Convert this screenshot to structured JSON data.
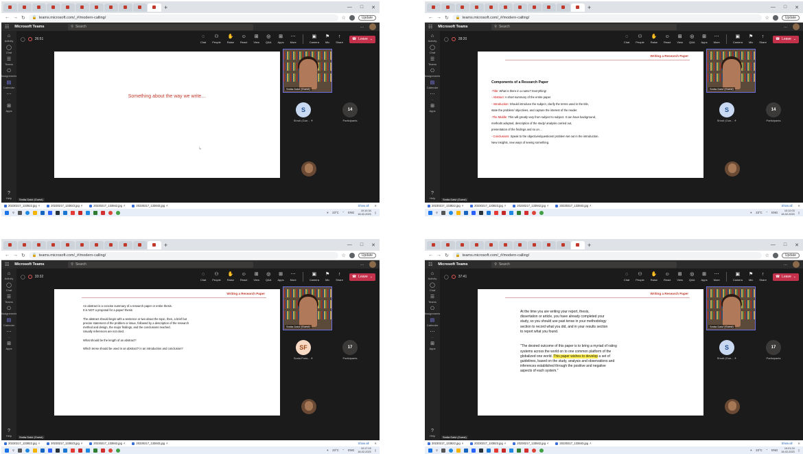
{
  "browser": {
    "url": "teams.microsoft.com/_#/modern-calling/",
    "update_label": "Update",
    "new_tab": "+"
  },
  "teams": {
    "app_name": "Microsoft Teams",
    "search_placeholder": "Search",
    "more": "...",
    "rail": [
      {
        "label": "Activity",
        "icon": "bell-icon"
      },
      {
        "label": "Chat",
        "icon": "chat-icon"
      },
      {
        "label": "Teams",
        "icon": "teams-icon"
      },
      {
        "label": "Assignments",
        "icon": "assignments-icon"
      },
      {
        "label": "Calendar",
        "icon": "calendar-icon"
      },
      {
        "label": "...",
        "icon": "more-icon"
      },
      {
        "label": "Apps",
        "icon": "apps-icon"
      },
      {
        "label": "Help",
        "icon": "help-icon"
      }
    ],
    "toolbar": [
      {
        "label": "Chat"
      },
      {
        "label": "People"
      },
      {
        "label": "Raise"
      },
      {
        "label": "React"
      },
      {
        "label": "View"
      },
      {
        "label": "Q&A"
      },
      {
        "label": "Apps"
      },
      {
        "label": "More"
      }
    ],
    "devices": [
      {
        "label": "Camera"
      },
      {
        "label": "Mic"
      },
      {
        "label": "Share"
      }
    ],
    "leave_label": "Leave"
  },
  "downloads": {
    "files": [
      "20230217_133822.jpg",
      "20230217_133823.jpg",
      "20230217_133842.jpg",
      "20230217_133843.jpg"
    ],
    "show_all": "Show all"
  },
  "taskbar": {
    "temp": "23°C",
    "lang": "ENG",
    "date": "18-02-2023"
  },
  "shots": [
    {
      "timer": "26:51",
      "clock": "10:10:34",
      "speaker_name": "Smita Dalvi (Guest)",
      "slide_title": "",
      "slide_center_text": "Something about the way we write…",
      "lines": [],
      "tile2": {
        "initials": "S",
        "name": "Shruti (Gue..."
      },
      "participant_count": "14",
      "participants_label": "Participants",
      "guest_label": "Smita Dalvi (Guest)"
    },
    {
      "timer": "28:20",
      "clock": "10:12:03",
      "speaker_name": "Smita Dalvi (Guest)",
      "slide_title": "Writing a Research Paper",
      "slide_center_text": "",
      "heading": "Components of a Research Paper",
      "lines": [
        {
          "label": "-Title:",
          "text": " What is there in a name? Everything!"
        },
        {
          "label": "- Abstract:",
          "text": " A short summary of the entire paper"
        },
        {
          "label": " - Introduction:",
          "text": " Should introduce the subject, clarify the terms used in the title,"
        },
        {
          "label": "",
          "text": "          state the problem/ objectives, and capture the interest of the reader."
        },
        {
          "label": "-The Middle:",
          "text": " This will greatly vary from subject to subject. It can have background,"
        },
        {
          "label": "",
          "text": "          methods adopted, description of the study/ analysis carried out,"
        },
        {
          "label": "",
          "text": "          presentation of the findings and so on…"
        },
        {
          "label": " - Conclusions:",
          "text": " Speak to the objectives/questions/ problem set out in the introduction."
        },
        {
          "label": "",
          "text": "          New insights, new ways of seeing something."
        }
      ],
      "tile2": {
        "initials": "S",
        "name": "Shruti (Gue..."
      },
      "participant_count": "14",
      "participants_label": "Participants",
      "guest_label": "Smita Dalvi (Guest)"
    },
    {
      "timer": "33:32",
      "clock": "10:17:15",
      "speaker_name": "Smita Dalvi (Guest)",
      "slide_title": "Writing a Research Paper",
      "slide_center_text": "",
      "heading": "",
      "lines": [
        {
          "label": "",
          "text": "An abstract is a concise summary of a research paper or entire thesis."
        },
        {
          "label": "",
          "text": "It is NOT a proposal for a paper/ thesis"
        },
        {
          "label": "",
          "text": ""
        },
        {
          "label": "",
          "text": "The abstract should begin with a sentence or two about the topic, then, a brief but"
        },
        {
          "label": "",
          "text": "precise statement of the problem or issue, followed by a description of the research"
        },
        {
          "label": "",
          "text": "method and design, the major findings, and the conclusions reached."
        },
        {
          "label": "",
          "text": "Usually references are not cited."
        },
        {
          "label": "",
          "text": ""
        },
        {
          "label": "",
          "text": "What should be the length of an abstract?"
        },
        {
          "label": "",
          "text": ""
        },
        {
          "label": "",
          "text": "Which tense should be used in an abstract? in an introduction and conclusion?"
        }
      ],
      "tile2": {
        "initials": "SF",
        "name": "Sonia Fons..."
      },
      "participant_count": "17",
      "participants_label": "Participants",
      "guest_label": "Smita Dalvi (Guest)"
    },
    {
      "timer": "37:41",
      "clock": "10:21:24",
      "speaker_name": "Smita Dalvi (Guest)",
      "slide_title": "Writing a Research Paper",
      "slide_center_text": "",
      "heading": "",
      "lines": [
        {
          "label": "",
          "text": "At the time you are writing your report, thesis,"
        },
        {
          "label": "",
          "text": "dissertation or article, you have already completed your"
        },
        {
          "label": "",
          "text": "study, so you should use past tense in your methodology"
        },
        {
          "label": "",
          "text": "section to record what you did, and in your results section"
        },
        {
          "label": "",
          "text": "to report what you found."
        },
        {
          "label": "",
          "text": ""
        },
        {
          "label": "",
          "text": ""
        },
        {
          "label": "",
          "text": "\"The desired outcome of this paper is to bring a myriad of rating"
        },
        {
          "label": "",
          "text": "systems across the world on to one common platform of the"
        },
        {
          "label": "",
          "text": "globalized one world. ",
          "hl": "This paper wishes to develop",
          "after": " a set of"
        },
        {
          "label": "",
          "text": "guidelines, based on the study, analysis and observations and"
        },
        {
          "label": "",
          "text": "inferences established through the positive and negative"
        },
        {
          "label": "",
          "text": "aspects of each system.\""
        }
      ],
      "tile2": {
        "initials": "S",
        "name": "Shruti (Gue..."
      },
      "participant_count": "17",
      "participants_label": "Participants",
      "guest_label": "Smita Dalvi (Guest)"
    }
  ],
  "colors": {
    "accent": "#7f85f5",
    "leave": "#c4314b",
    "slide_red": "#c0392b",
    "highlight": "#ffef4f"
  }
}
